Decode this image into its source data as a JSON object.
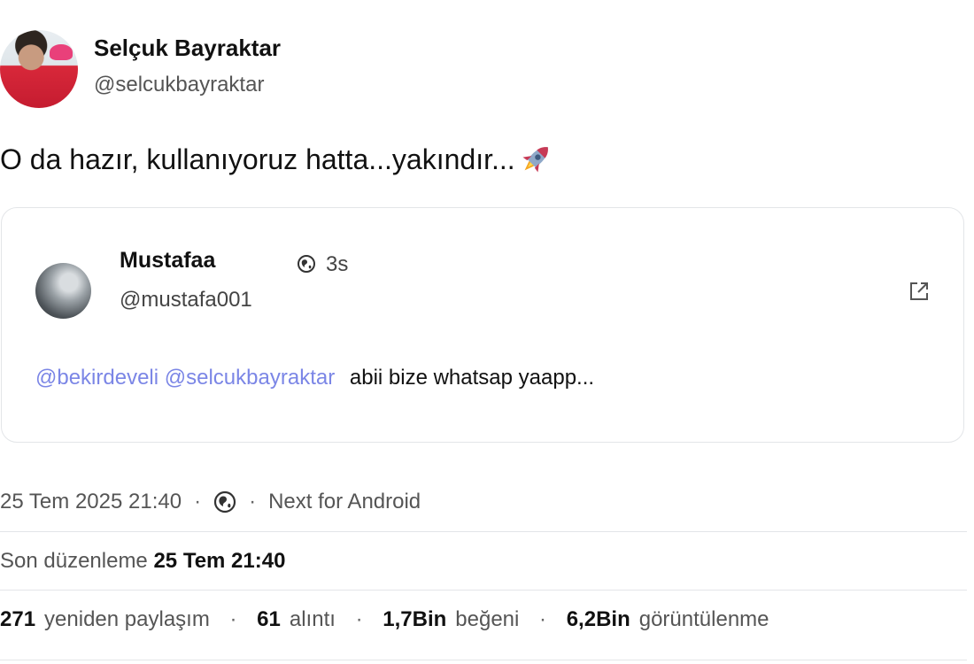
{
  "author": {
    "name": "Selçuk Bayraktar",
    "handle": "@selcukbayraktar"
  },
  "post": {
    "text": "O da hazır, kullanıyoruz hatta...yakındır...",
    "emoji_icon": "rocket-icon"
  },
  "quote": {
    "name": "Mustafaa",
    "handle": "@mustafa001",
    "time": "3s",
    "mention_1": "@bekirdeveli",
    "mention_2": "@selcukbayraktar",
    "text": "abii bize whatsap yaapp...",
    "open_icon": "external-link-icon"
  },
  "meta": {
    "date": "25 Tem 2025 21:40",
    "visibility_icon": "globe-icon",
    "client": "Next for Android"
  },
  "edited": {
    "label": "Son düzenleme",
    "date": "25 Tem 21:40"
  },
  "stats": {
    "reposts": "271",
    "reposts_label": "yeniden paylaşım",
    "quotes": "61",
    "quotes_label": "alıntı",
    "likes": "1,7Bin",
    "likes_label": "beğeni",
    "views": "6,2Bin",
    "views_label": "görüntülenme"
  },
  "colors": {
    "mention": "#7b86e6",
    "divider": "#e3e5e8"
  }
}
